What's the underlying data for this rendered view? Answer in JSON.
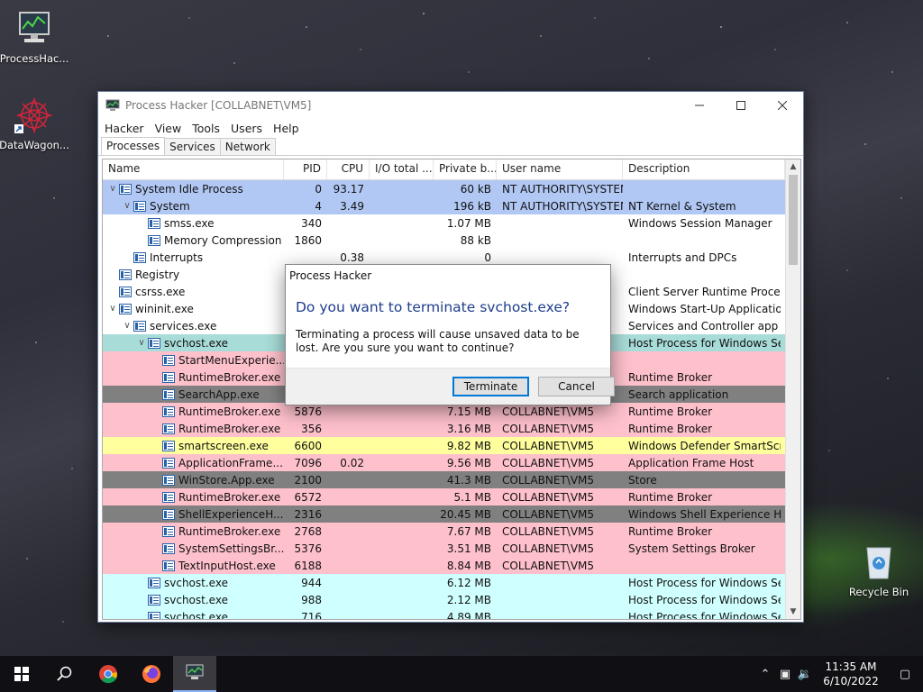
{
  "desktop": {
    "icons": [
      {
        "label": "ProcessHac..."
      },
      {
        "label": "DataWagon..."
      },
      {
        "label": "Recycle Bin"
      }
    ]
  },
  "window": {
    "title": "Process Hacker [COLLABNET\\VM5]",
    "menu": [
      "Hacker",
      "View",
      "Tools",
      "Users",
      "Help"
    ],
    "tabs": [
      "Processes",
      "Services",
      "Network"
    ],
    "active_tab": "Processes",
    "columns": [
      "Name",
      "PID",
      "CPU",
      "I/O total ...",
      "Private b...",
      "User name",
      "Description"
    ],
    "rows": [
      {
        "indent": 0,
        "expander": "v",
        "name": "System Idle Process",
        "pid": "0",
        "cpu": "93.17",
        "io": "",
        "priv": "60 kB",
        "user": "NT AUTHORITY\\SYSTEM",
        "desc": "",
        "bg": "#b2c8f4"
      },
      {
        "indent": 1,
        "expander": "v",
        "name": "System",
        "pid": "4",
        "cpu": "3.49",
        "io": "",
        "priv": "196 kB",
        "user": "NT AUTHORITY\\SYSTEM",
        "desc": "NT Kernel & System",
        "bg": "#b2c8f4"
      },
      {
        "indent": 2,
        "expander": "",
        "name": "smss.exe",
        "pid": "340",
        "cpu": "",
        "io": "",
        "priv": "1.07 MB",
        "user": "",
        "desc": "Windows Session Manager",
        "bg": "#ffffff"
      },
      {
        "indent": 2,
        "expander": "",
        "name": "Memory Compression",
        "pid": "1860",
        "cpu": "",
        "io": "",
        "priv": "88 kB",
        "user": "",
        "desc": "",
        "bg": "#ffffff"
      },
      {
        "indent": 1,
        "expander": "",
        "name": "Interrupts",
        "pid": "",
        "cpu": "0.38",
        "io": "",
        "priv": "0",
        "user": "",
        "desc": "Interrupts and DPCs",
        "bg": "#ffffff"
      },
      {
        "indent": 0,
        "expander": "",
        "name": "Registry",
        "pid": "",
        "cpu": "",
        "io": "",
        "priv": "",
        "user": "",
        "desc": "",
        "bg": "#ffffff"
      },
      {
        "indent": 0,
        "expander": "",
        "name": "csrss.exe",
        "pid": "",
        "cpu": "",
        "io": "",
        "priv": "",
        "user": "",
        "desc": "Client Server Runtime Process",
        "bg": "#ffffff"
      },
      {
        "indent": 0,
        "expander": "v",
        "name": "wininit.exe",
        "pid": "",
        "cpu": "",
        "io": "",
        "priv": "",
        "user": "",
        "desc": "Windows Start-Up Application",
        "bg": "#ffffff"
      },
      {
        "indent": 1,
        "expander": "v",
        "name": "services.exe",
        "pid": "",
        "cpu": "",
        "io": "",
        "priv": "",
        "user": "",
        "desc": "Services and Controller app",
        "bg": "#ffffff"
      },
      {
        "indent": 2,
        "expander": "v",
        "name": "svchost.exe",
        "pid": "",
        "cpu": "",
        "io": "",
        "priv": "",
        "user": "",
        "desc": "Host Process for Windows Ser...",
        "bg": "#a8dcd8"
      },
      {
        "indent": 3,
        "expander": "",
        "name": "StartMenuExperie...",
        "pid": "",
        "cpu": "",
        "io": "",
        "priv": "",
        "user": "",
        "desc": "",
        "bg": "#fec0cb"
      },
      {
        "indent": 3,
        "expander": "",
        "name": "RuntimeBroker.exe",
        "pid": "",
        "cpu": "",
        "io": "",
        "priv": "",
        "user": "",
        "desc": "Runtime Broker",
        "bg": "#fec0cb"
      },
      {
        "indent": 3,
        "expander": "",
        "name": "SearchApp.exe",
        "pid": "",
        "cpu": "",
        "io": "",
        "priv": "",
        "user": "",
        "desc": "Search application",
        "bg": "#808080"
      },
      {
        "indent": 3,
        "expander": "",
        "name": "RuntimeBroker.exe",
        "pid": "5876",
        "cpu": "",
        "io": "",
        "priv": "7.15 MB",
        "user": "COLLABNET\\VM5",
        "desc": "Runtime Broker",
        "bg": "#fec0cb"
      },
      {
        "indent": 3,
        "expander": "",
        "name": "RuntimeBroker.exe",
        "pid": "356",
        "cpu": "",
        "io": "",
        "priv": "3.16 MB",
        "user": "COLLABNET\\VM5",
        "desc": "Runtime Broker",
        "bg": "#fec0cb"
      },
      {
        "indent": 3,
        "expander": "",
        "name": "smartscreen.exe",
        "pid": "6600",
        "cpu": "",
        "io": "",
        "priv": "9.82 MB",
        "user": "COLLABNET\\VM5",
        "desc": "Windows Defender SmartScre...",
        "bg": "#ffff9e"
      },
      {
        "indent": 3,
        "expander": "",
        "name": "ApplicationFrame...",
        "pid": "7096",
        "cpu": "0.02",
        "io": "",
        "priv": "9.56 MB",
        "user": "COLLABNET\\VM5",
        "desc": "Application Frame Host",
        "bg": "#fec0cb"
      },
      {
        "indent": 3,
        "expander": "",
        "name": "WinStore.App.exe",
        "pid": "2100",
        "cpu": "",
        "io": "",
        "priv": "41.3 MB",
        "user": "COLLABNET\\VM5",
        "desc": "Store",
        "bg": "#808080"
      },
      {
        "indent": 3,
        "expander": "",
        "name": "RuntimeBroker.exe",
        "pid": "6572",
        "cpu": "",
        "io": "",
        "priv": "5.1 MB",
        "user": "COLLABNET\\VM5",
        "desc": "Runtime Broker",
        "bg": "#fec0cb"
      },
      {
        "indent": 3,
        "expander": "",
        "name": "ShellExperienceH...",
        "pid": "2316",
        "cpu": "",
        "io": "",
        "priv": "20.45 MB",
        "user": "COLLABNET\\VM5",
        "desc": "Windows Shell Experience Host",
        "bg": "#808080"
      },
      {
        "indent": 3,
        "expander": "",
        "name": "RuntimeBroker.exe",
        "pid": "2768",
        "cpu": "",
        "io": "",
        "priv": "7.67 MB",
        "user": "COLLABNET\\VM5",
        "desc": "Runtime Broker",
        "bg": "#fec0cb"
      },
      {
        "indent": 3,
        "expander": "",
        "name": "SystemSettingsBr...",
        "pid": "5376",
        "cpu": "",
        "io": "",
        "priv": "3.51 MB",
        "user": "COLLABNET\\VM5",
        "desc": "System Settings Broker",
        "bg": "#fec0cb"
      },
      {
        "indent": 3,
        "expander": "",
        "name": "TextInputHost.exe",
        "pid": "6188",
        "cpu": "",
        "io": "",
        "priv": "8.84 MB",
        "user": "COLLABNET\\VM5",
        "desc": "",
        "bg": "#fec0cb"
      },
      {
        "indent": 2,
        "expander": "",
        "name": "svchost.exe",
        "pid": "944",
        "cpu": "",
        "io": "",
        "priv": "6.12 MB",
        "user": "",
        "desc": "Host Process for Windows Ser...",
        "bg": "#d0ffff"
      },
      {
        "indent": 2,
        "expander": "",
        "name": "svchost.exe",
        "pid": "988",
        "cpu": "",
        "io": "",
        "priv": "2.12 MB",
        "user": "",
        "desc": "Host Process for Windows Ser...",
        "bg": "#d0ffff"
      },
      {
        "indent": 2,
        "expander": "",
        "name": "svchost.exe",
        "pid": "716",
        "cpu": "",
        "io": "",
        "priv": "4.89 MB",
        "user": "",
        "desc": "Host Process for Windows Ser...",
        "bg": "#d0ffff"
      }
    ]
  },
  "dialog": {
    "title": "Process Hacker",
    "heading": "Do you want to terminate svchost.exe?",
    "message": "Terminating a process will cause unsaved data to be lost. Are you sure you want to continue?",
    "confirm_label": "Terminate",
    "cancel_label": "Cancel"
  },
  "taskbar": {
    "items": [
      "start-icon",
      "search-icon",
      "chrome-icon",
      "firefox-icon",
      "process-hacker-icon"
    ],
    "time": "11:35 AM",
    "date": "6/10/2022"
  }
}
